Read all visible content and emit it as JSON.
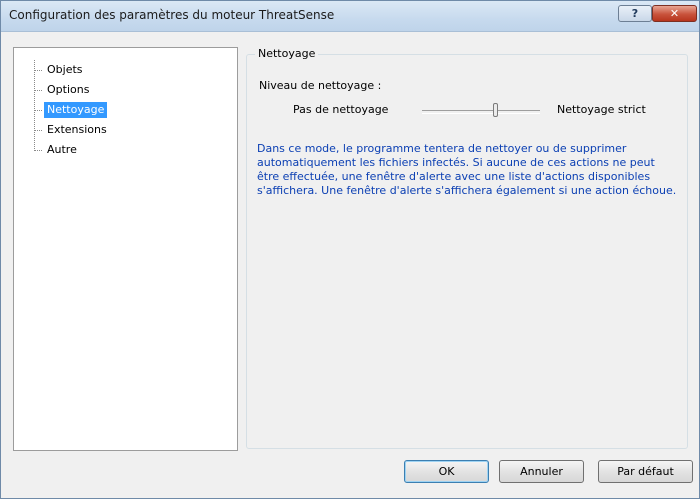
{
  "window": {
    "title": "Configuration des paramètres du moteur ThreatSense",
    "help_label": "?",
    "close_label": "✕"
  },
  "tree": {
    "items": [
      {
        "label": "Objets",
        "selected": false
      },
      {
        "label": "Options",
        "selected": false
      },
      {
        "label": "Nettoyage",
        "selected": true
      },
      {
        "label": "Extensions",
        "selected": false
      },
      {
        "label": "Autre",
        "selected": false
      }
    ]
  },
  "cleaning": {
    "group_title": "Nettoyage",
    "level_label": "Niveau de nettoyage :",
    "slider_min_label": "Pas de nettoyage",
    "slider_max_label": "Nettoyage strict",
    "description": "Dans ce mode, le programme tentera de nettoyer ou de supprimer automatiquement les fichiers infectés. Si aucune de ces actions ne peut être effectuée, une fenêtre d'alerte avec une liste d'actions disponibles s'affichera. Une fenêtre d'alerte s'affichera également si une action échoue."
  },
  "buttons": {
    "ok": "OK",
    "cancel": "Annuler",
    "default": "Par défaut"
  },
  "colors": {
    "selection": "#3399ff",
    "description_text": "#0b3fb3",
    "close_button": "#c8533c"
  }
}
